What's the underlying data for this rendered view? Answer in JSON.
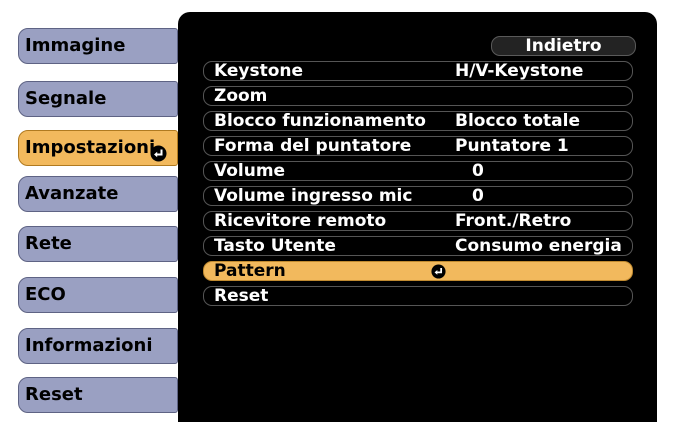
{
  "sidebar": {
    "items": [
      {
        "label": "Immagine"
      },
      {
        "label": "Segnale"
      },
      {
        "label": "Impostazioni"
      },
      {
        "label": "Avanzate"
      },
      {
        "label": "Rete"
      },
      {
        "label": "ECO"
      },
      {
        "label": "Informazioni"
      },
      {
        "label": "Reset"
      }
    ],
    "selected_index": 2
  },
  "menu": {
    "back_label": "Indietro",
    "rows": [
      {
        "label": "Keystone",
        "value": "H/V-Keystone"
      },
      {
        "label": "Zoom",
        "value": ""
      },
      {
        "label": "Blocco funzionamento",
        "value": "Blocco totale"
      },
      {
        "label": "Forma del puntatore",
        "value": "Puntatore 1"
      },
      {
        "label": "Volume",
        "value": "0"
      },
      {
        "label": "Volume ingresso mic",
        "value": "0"
      },
      {
        "label": "Ricevitore remoto",
        "value": "Front./Retro"
      },
      {
        "label": "Tasto Utente",
        "value": "Consumo energia"
      },
      {
        "label": "Pattern",
        "value": ""
      },
      {
        "label": "Reset",
        "value": ""
      }
    ],
    "selected_index": 8
  },
  "colors": {
    "selected": "#f2b95d",
    "tab": "#9aa0c2",
    "panel": "#000000"
  },
  "icons": {
    "enter": "enter-icon"
  }
}
